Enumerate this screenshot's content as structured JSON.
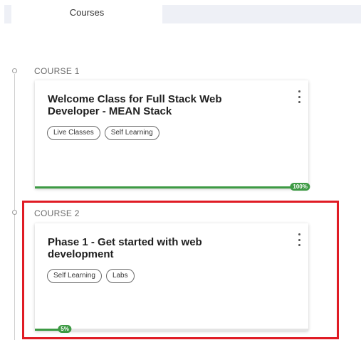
{
  "tabs": {
    "active_label": "Courses"
  },
  "courses": [
    {
      "label": "COURSE 1",
      "title": "Welcome Class for Full Stack Web Developer - MEAN Stack",
      "tags": [
        "Live Classes",
        "Self Learning"
      ],
      "progress_percent": 100,
      "progress_label": "100%"
    },
    {
      "label": "COURSE 2",
      "title": "Phase 1 - Get started with web development",
      "tags": [
        "Self Learning",
        "Labs"
      ],
      "progress_percent": 5,
      "progress_label": "5%"
    }
  ],
  "colors": {
    "progress": "#3d9a44",
    "highlight": "#e01b24",
    "tab_bg": "#eef0f6"
  },
  "icons": {
    "menu": "more-vertical-icon",
    "timeline": "circle-dot-icon"
  }
}
